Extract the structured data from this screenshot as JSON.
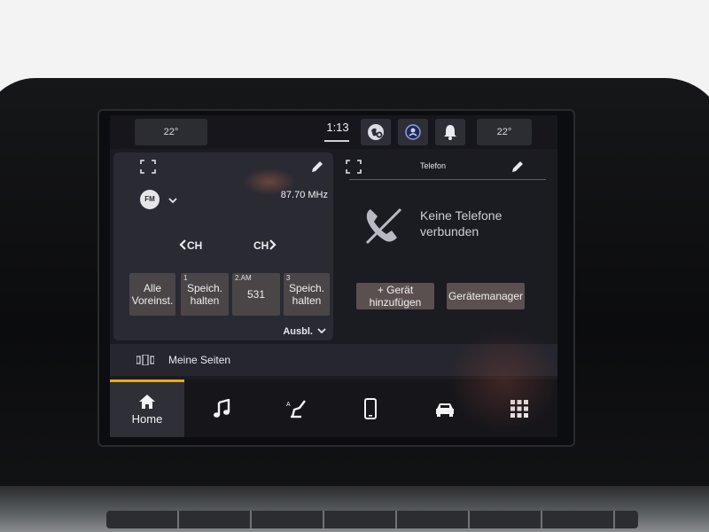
{
  "status_bar": {
    "temp_left": "22°",
    "time": "1:13",
    "temp_right": "22°",
    "icons": [
      "navigation-globe-icon",
      "assistant-icon",
      "notification-bell-icon"
    ]
  },
  "radio": {
    "band": "FM",
    "frequency": "87.70 MHz",
    "ch_prev": "CH",
    "ch_next": "CH",
    "presets": [
      {
        "number": "",
        "label": "Alle Voreinst."
      },
      {
        "number": "1",
        "label": "Speich. halten"
      },
      {
        "number": "2.AM",
        "label": "531"
      },
      {
        "number": "3",
        "label": "Speich. halten"
      }
    ],
    "ausbl_label": "Ausbl."
  },
  "phone": {
    "title": "Telefon",
    "status_text": "Keine Telefone verbunden",
    "add_device_label": "+ Gerät hinzufügen",
    "device_manager_label": "Gerätemanager"
  },
  "meine_seiten": {
    "label": "Meine Seiten"
  },
  "nav": {
    "items": [
      {
        "label": "Home",
        "icon": "home-icon"
      },
      {
        "label": "",
        "icon": "music-note-icon"
      },
      {
        "label": "",
        "icon": "seat-comfort-icon"
      },
      {
        "label": "",
        "icon": "smartphone-icon"
      },
      {
        "label": "",
        "icon": "car-icon"
      },
      {
        "label": "",
        "icon": "apps-grid-icon"
      }
    ],
    "active_color": "#e7a922"
  }
}
